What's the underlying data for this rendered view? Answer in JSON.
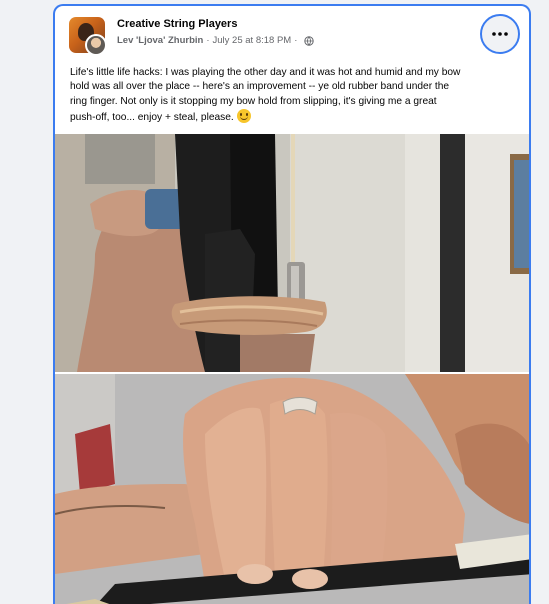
{
  "post": {
    "group_name": "Creative String Players",
    "author": "Lev 'Ljova' Zhurbin",
    "separator": "·",
    "timestamp": "July 25 at 8:18 PM",
    "separator2": "·",
    "audience_icon": "globe-icon",
    "more_icon": "ellipsis-icon",
    "text_lines": [
      "Life's little life hacks: I was playing the other day and it was hot and humid and my bow",
      "hold was all over the place -- here's an improvement -- ye old rubber band under the",
      "ring finger.  Not only is it stopping my bow hold from slipping, it's giving me a great",
      "push-off, too...   enjoy + steal, please."
    ],
    "emoji": "slightly-smiling-face-emoji",
    "photos": [
      {
        "alt_icon": "photo-bow-rubber-band"
      },
      {
        "alt_icon": "photo-hand-bow-hold"
      }
    ]
  },
  "colors": {
    "accent": "#3b7cf0",
    "background": "#f0f2f5",
    "text": "#050505",
    "meta": "#65676b"
  }
}
